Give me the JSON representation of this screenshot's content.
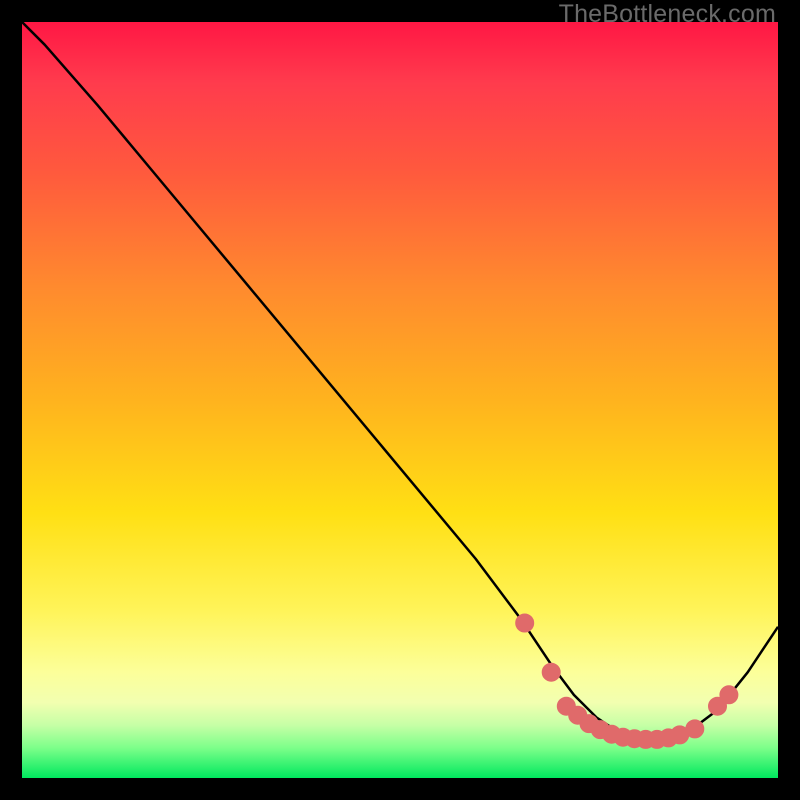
{
  "watermark": "TheBottleneck.com",
  "chart_data": {
    "type": "line",
    "title": "",
    "xlabel": "",
    "ylabel": "",
    "xlim": [
      0,
      100
    ],
    "ylim": [
      0,
      100
    ],
    "series": [
      {
        "name": "curve",
        "x": [
          0,
          3,
          10,
          20,
          30,
          40,
          50,
          60,
          66,
          70,
          73,
          76,
          79,
          82,
          85,
          88,
          92,
          96,
          100
        ],
        "y": [
          100,
          97,
          89,
          77,
          65,
          53,
          41,
          29,
          21,
          15,
          11,
          8,
          6,
          5,
          5,
          6,
          9,
          14,
          20
        ]
      }
    ],
    "curve_markers": {
      "color": "#e36a6a",
      "x": [
        66.5,
        70,
        72,
        73.5,
        75,
        76.5,
        78,
        79.5,
        81,
        82.5,
        84,
        85.5,
        87,
        89,
        92,
        93.5
      ],
      "y": [
        20.5,
        14,
        9.5,
        8.3,
        7.2,
        6.4,
        5.8,
        5.4,
        5.2,
        5.1,
        5.1,
        5.3,
        5.7,
        6.5,
        9.5,
        11
      ]
    },
    "background_gradient": {
      "stops": [
        {
          "pos": 0,
          "color": "#ff1744"
        },
        {
          "pos": 20,
          "color": "#ff5a3d"
        },
        {
          "pos": 50,
          "color": "#ffb31e"
        },
        {
          "pos": 78,
          "color": "#fff45a"
        },
        {
          "pos": 93,
          "color": "#c6ffa6"
        },
        {
          "pos": 100,
          "color": "#00e85e"
        }
      ]
    }
  }
}
